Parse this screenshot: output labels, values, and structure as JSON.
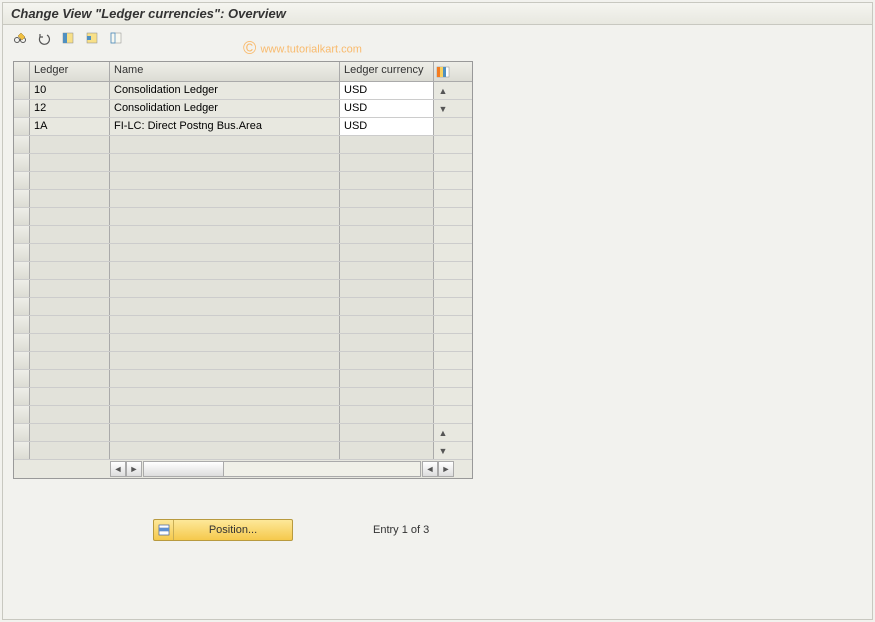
{
  "title": "Change View \"Ledger currencies\": Overview",
  "watermark": "www.tutorialkart.com",
  "columns": {
    "ledger": "Ledger",
    "name": "Name",
    "currency": "Ledger currency"
  },
  "rows": [
    {
      "ledger": "10",
      "name": "Consolidation Ledger",
      "currency": "USD"
    },
    {
      "ledger": "12",
      "name": "Consolidation Ledger",
      "currency": "USD"
    },
    {
      "ledger": "1A",
      "name": "FI-LC: Direct Postng Bus.Area",
      "currency": "USD"
    }
  ],
  "empty_row_count": 18,
  "footer": {
    "position_label": "Position...",
    "entry_text": "Entry 1 of 3"
  }
}
